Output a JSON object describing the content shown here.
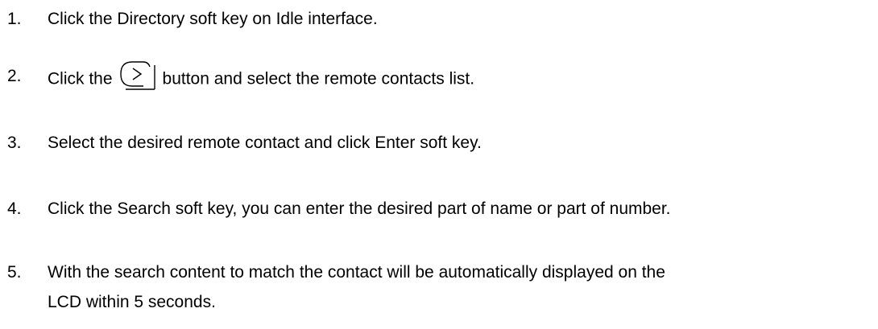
{
  "steps": [
    {
      "number": "1.",
      "text": "Click the Directory soft key on Idle interface."
    },
    {
      "number": "2.",
      "text_before": "Click the",
      "text_after": "button and select the remote contacts list.",
      "icon": "navigate-right-button-icon"
    },
    {
      "number": "3.",
      "text": "Select the desired remote contact and click Enter soft key."
    },
    {
      "number": "4.",
      "text": "Click the Search soft key, you can enter the desired part of name or part of number."
    },
    {
      "number": "5.",
      "text_line1": "With the search content to match the contact will be automatically displayed on the",
      "text_line2": "LCD within 5 seconds."
    }
  ]
}
